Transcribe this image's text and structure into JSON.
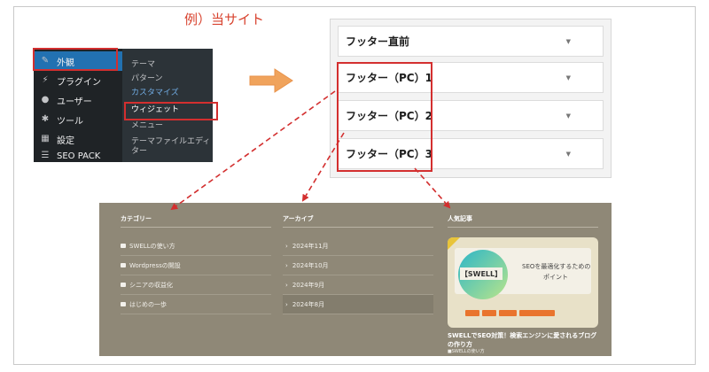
{
  "example_title": "例）当サイト",
  "wp_menu": {
    "items": [
      {
        "label": "外観",
        "icon": "paintbrush-icon",
        "active": true
      },
      {
        "label": "プラグイン",
        "icon": "plug-icon"
      },
      {
        "label": "ユーザー",
        "icon": "user-icon"
      },
      {
        "label": "ツール",
        "icon": "wrench-icon"
      },
      {
        "label": "設定",
        "icon": "settings-icon"
      },
      {
        "label": "SEO PACK",
        "icon": "list-icon"
      }
    ],
    "submenu": [
      "テーマ",
      "パターン",
      "カスタマイズ",
      "ウィジェット",
      "メニュー",
      "テーマファイルエディ",
      "ター"
    ]
  },
  "widget_areas": [
    "フッター直前",
    "フッター（PC）1",
    "フッター（PC）2",
    "フッター（PC）3"
  ],
  "footer": {
    "categories": {
      "heading": "カテゴリー",
      "items": [
        "SWELLの使い方",
        "Wordpressの開設",
        "シニアの収益化",
        "はじめの一歩"
      ]
    },
    "archive": {
      "heading": "アーカイブ",
      "items": [
        "2024年11月",
        "2024年10月",
        "2024年9月",
        "2024年8月"
      ]
    },
    "popular": {
      "heading": "人気記事",
      "thumb_label": "【SWELL】",
      "thumb_text_1": "SEOを最適化するための",
      "thumb_text_2": "ポイント",
      "post_title": "SWELLでSEO対策！検索エンジンに愛されるブログの作り方",
      "post_category": "SWELLの使い方"
    }
  },
  "colors": {
    "accent_red": "#d32f2f",
    "footer_bg": "#8f8877",
    "wp_active": "#2271b1",
    "arrow_orange": "#f0a35c"
  }
}
